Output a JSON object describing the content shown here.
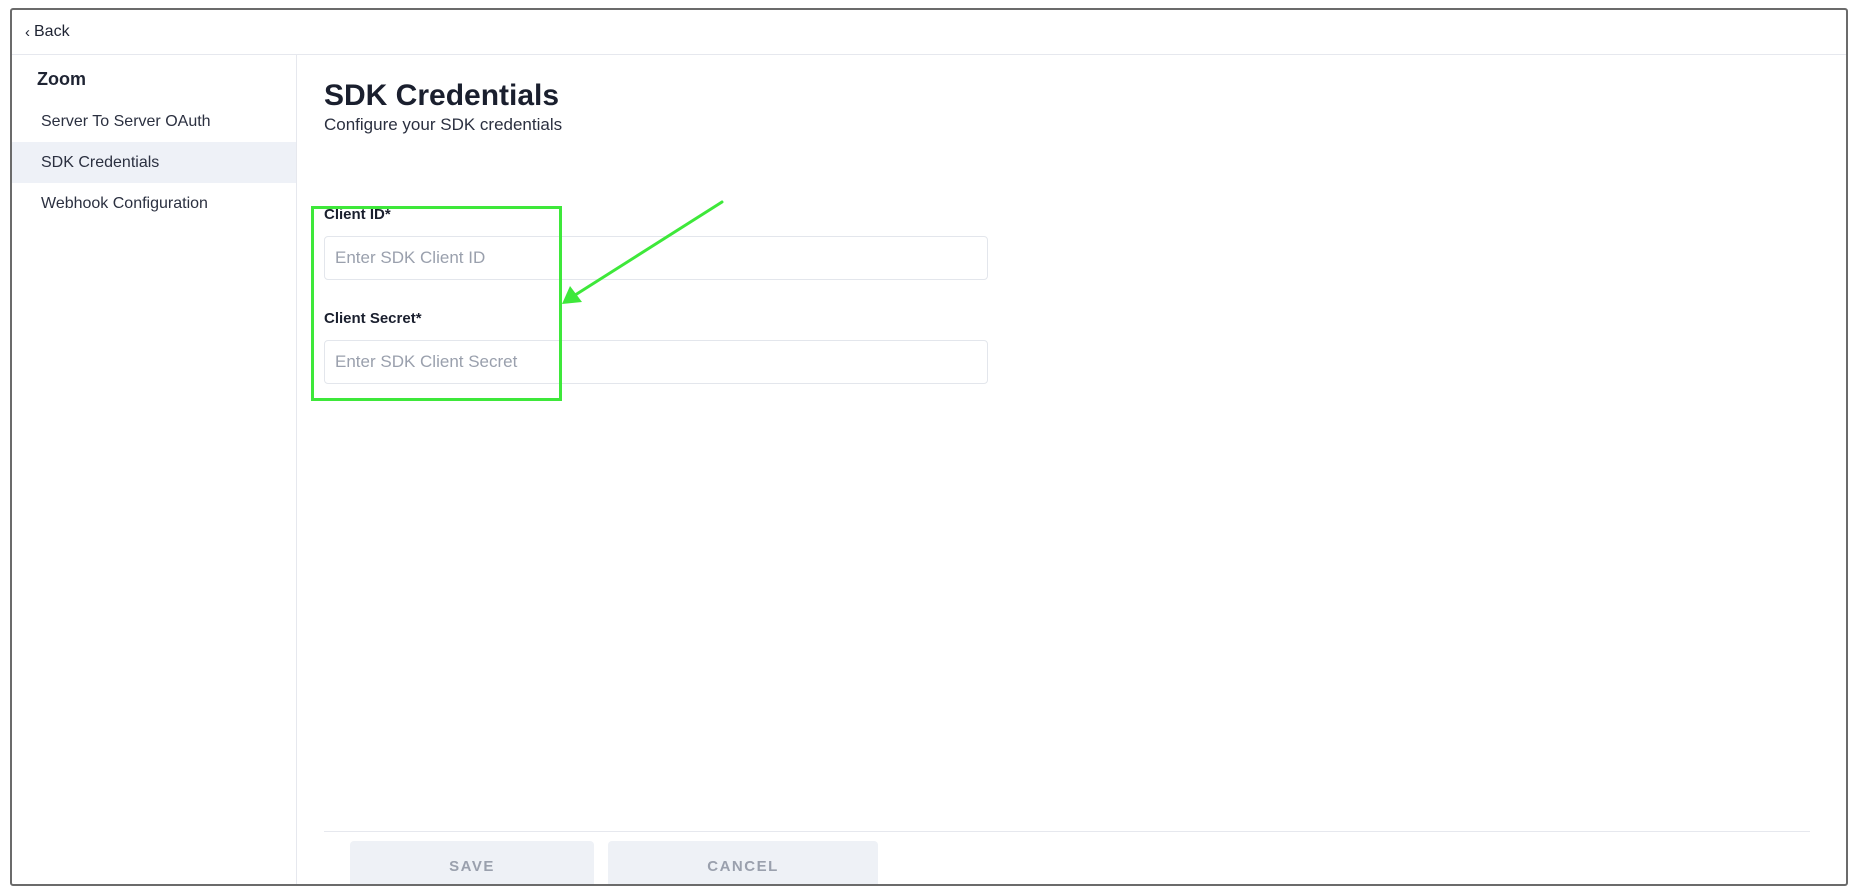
{
  "topbar": {
    "back_label": "Back"
  },
  "sidebar": {
    "heading": "Zoom",
    "items": [
      {
        "label": "Server To Server OAuth",
        "active": false
      },
      {
        "label": "SDK Credentials",
        "active": true
      },
      {
        "label": "Webhook Configuration",
        "active": false
      }
    ]
  },
  "main": {
    "title": "SDK Credentials",
    "subtitle": "Configure your SDK credentials",
    "fields": {
      "client_id": {
        "label": "Client ID*",
        "value": "",
        "placeholder": "Enter SDK Client ID"
      },
      "client_secret": {
        "label": "Client Secret*",
        "value": "",
        "placeholder": "Enter SDK Client Secret"
      }
    },
    "buttons": {
      "save_label": "SAVE",
      "cancel_label": "CANCEL"
    }
  },
  "colors": {
    "annotation": "#3ee83a",
    "active_nav_bg": "#eef1f7",
    "button_bg": "#eef1f6",
    "button_text": "#9aa0ad"
  },
  "icons": {
    "back": "chevron-left-icon",
    "annotation_arrow": "arrow-icon"
  }
}
